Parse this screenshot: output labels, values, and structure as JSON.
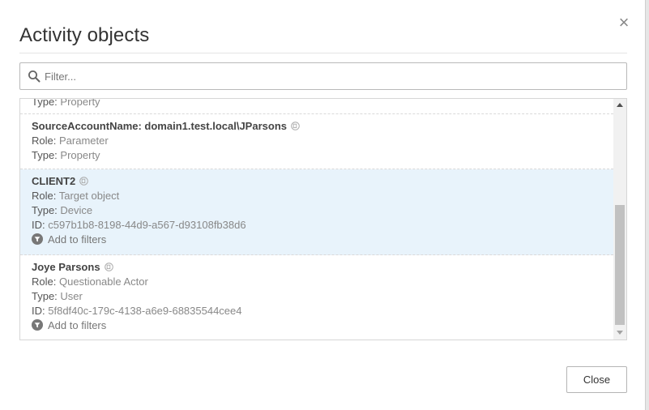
{
  "dialog": {
    "title": "Activity objects",
    "close_symbol": "×"
  },
  "filter": {
    "placeholder": "Filter...",
    "value": "",
    "icon": "search-icon"
  },
  "list": {
    "partial_top": {
      "type_key": "Type:",
      "type_value": "Property"
    },
    "items": [
      {
        "name": "SourceAccountName: domain1.test.local\\JParsons",
        "role_key": "Role:",
        "role_value": "Parameter",
        "type_key": "Type:",
        "type_value": "Property"
      },
      {
        "name": "CLIENT2",
        "role_key": "Role:",
        "role_value": "Target object",
        "type_key": "Type:",
        "type_value": "Device",
        "id_key": "ID:",
        "id_value": "c597b1b8-8198-44d9-a567-d93108fb38d6",
        "add_filters": "Add to filters",
        "selected": true
      },
      {
        "name": "Joye Parsons",
        "role_key": "Role:",
        "role_value": "Questionable Actor",
        "type_key": "Type:",
        "type_value": "User",
        "id_key": "ID:",
        "id_value": "5f8df40c-179c-4138-a6e9-68835544cee4",
        "add_filters": "Add to filters"
      }
    ]
  },
  "footer": {
    "close_label": "Close"
  },
  "colors": {
    "selected_row": "#e8f3fb",
    "muted_text": "#888888",
    "name_text": "#444444"
  }
}
